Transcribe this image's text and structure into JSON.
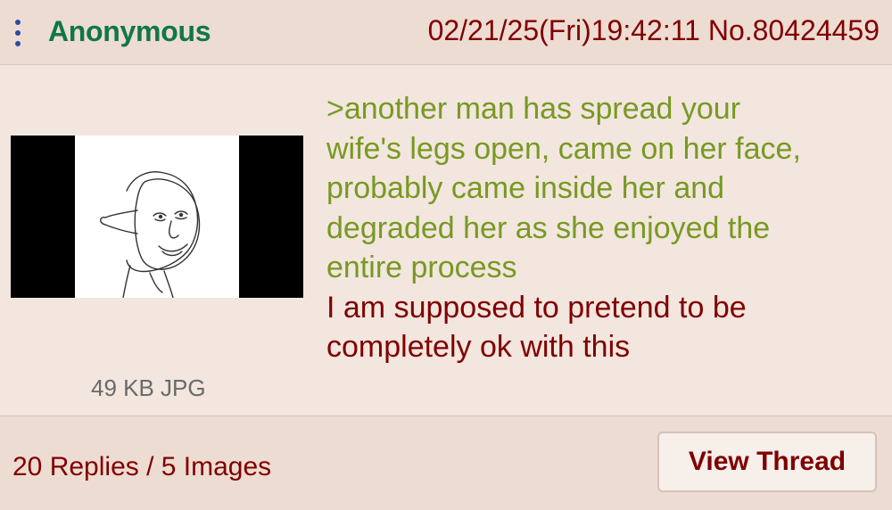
{
  "post": {
    "name": "Anonymous",
    "date_time": "02/21/25(Fri)19:42:11",
    "post_number": "No.80424459",
    "file_info": "49 KB JPG",
    "greentext_lines": [
      ">another man has spread your",
      "wife's legs open, came on her face,",
      "probably came inside her and",
      "degraded her as she enjoyed the",
      "entire process"
    ],
    "text_lines": [
      "I am supposed to pretend to be",
      "completely ok with this"
    ]
  },
  "footer": {
    "replies_summary": "20 Replies / 5 Images",
    "view_thread_label": "View Thread"
  },
  "colors": {
    "name_green": "#117743",
    "greentext": "#789922",
    "maroon": "#800000",
    "menu_blue": "#2b48a8",
    "background": "#f2e6de"
  },
  "icons": {
    "menu": "vertical-ellipsis-icon",
    "thumbnail": "wojak-mask-drawing"
  }
}
